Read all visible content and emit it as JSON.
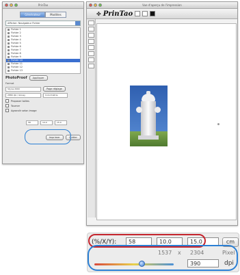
{
  "left_window": {
    "title": "PrinTao",
    "tabs": [
      "Générateur",
      "Modèles"
    ],
    "selector_label": "Afficher: Navigateur Fichier",
    "files": [
      "Fichier 1",
      "Fichier 2",
      "Fichier 3",
      "Fichier 4",
      "Fichier 5",
      "Fichier 6",
      "Fichier 7",
      "Fichier 8",
      "Fichier 9",
      "Fichier 10",
      "Fichier 11",
      "Fichier 12",
      "Fichier 13"
    ],
    "selected_file_index": 9,
    "brand": "PhotoProof",
    "apply_button": "Appliquer",
    "printer_label": "Format",
    "printer_value": "Stylus 2000",
    "page_setup_button": "Page réglage",
    "profile_value": "2880 dpi / Glossy",
    "rendering_value": "Colorimétrie",
    "options": [
      "Proposer tailles",
      "Tourner",
      "Agrandir selon image"
    ],
    "small_values": [
      "58",
      "10.0",
      "15.0"
    ],
    "print_button": "Imprimer",
    "quit_button": "Quitter"
  },
  "right_window": {
    "title": "Vue d'aperçu de l'impression",
    "logo": "PrinTao"
  },
  "zoom_panel": {
    "label": "(%/X/Y):",
    "percent": "58",
    "x": "10.0",
    "y": "15.0",
    "unit": "cm",
    "pixel_w": "1537",
    "times": "x",
    "pixel_h": "2304",
    "pixel_label": "Pixel",
    "dpi_value": "390",
    "dpi_label": "dpi",
    "slider_fraction": 0.6
  },
  "colors": {
    "highlight_red": "#c4232c",
    "highlight_blue": "#2a7fd4"
  }
}
